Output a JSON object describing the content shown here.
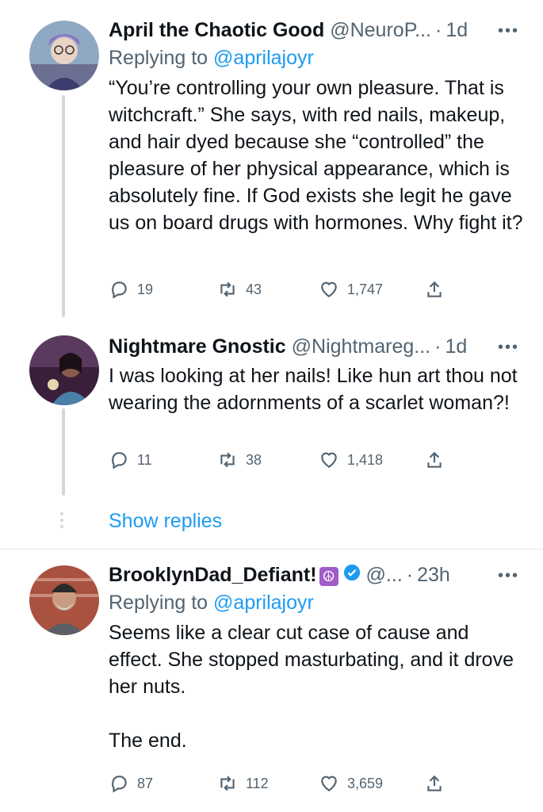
{
  "tweets": [
    {
      "name": "April the Chaotic Good",
      "handle": "@NeuroP...",
      "time": "1d",
      "replying_label": "Replying to",
      "replying_to": "@aprilajoyr",
      "text": "“You’re controlling your own pleasure. That is witchcraft.” She says, with red nails, makeup,  and hair dyed because she “controlled” the pleasure of her physical appearance, which is absolutely fine. If God exists she legit he gave us on board drugs with hormones. Why fight it?",
      "replies": "19",
      "retweets": "43",
      "likes": "1,747"
    },
    {
      "name": "Nightmare Gnostic",
      "handle": "@Nightmareg...",
      "time": "1d",
      "text": "I was looking at her nails! Like hun art thou not wearing the adornments of a scarlet woman?!",
      "replies": "11",
      "retweets": "38",
      "likes": "1,418"
    },
    {
      "name": "BrooklynDad_Defiant!",
      "emoji": "☮",
      "handle": "@...",
      "time": "23h",
      "replying_label": "Replying to",
      "replying_to": "@aprilajoyr",
      "text": "Seems like a clear cut case of cause and effect. She stopped masturbating, and it drove her nuts.\n\nThe end.",
      "replies": "87",
      "retweets": "112",
      "likes": "3,659"
    }
  ],
  "show_replies": "Show replies",
  "colors": {
    "link": "#1d9bf0",
    "muted": "#536471",
    "verified": "#1d9bf0"
  },
  "icons": [
    "reply-icon",
    "retweet-icon",
    "like-icon",
    "share-icon",
    "more-icon",
    "verified-icon"
  ]
}
